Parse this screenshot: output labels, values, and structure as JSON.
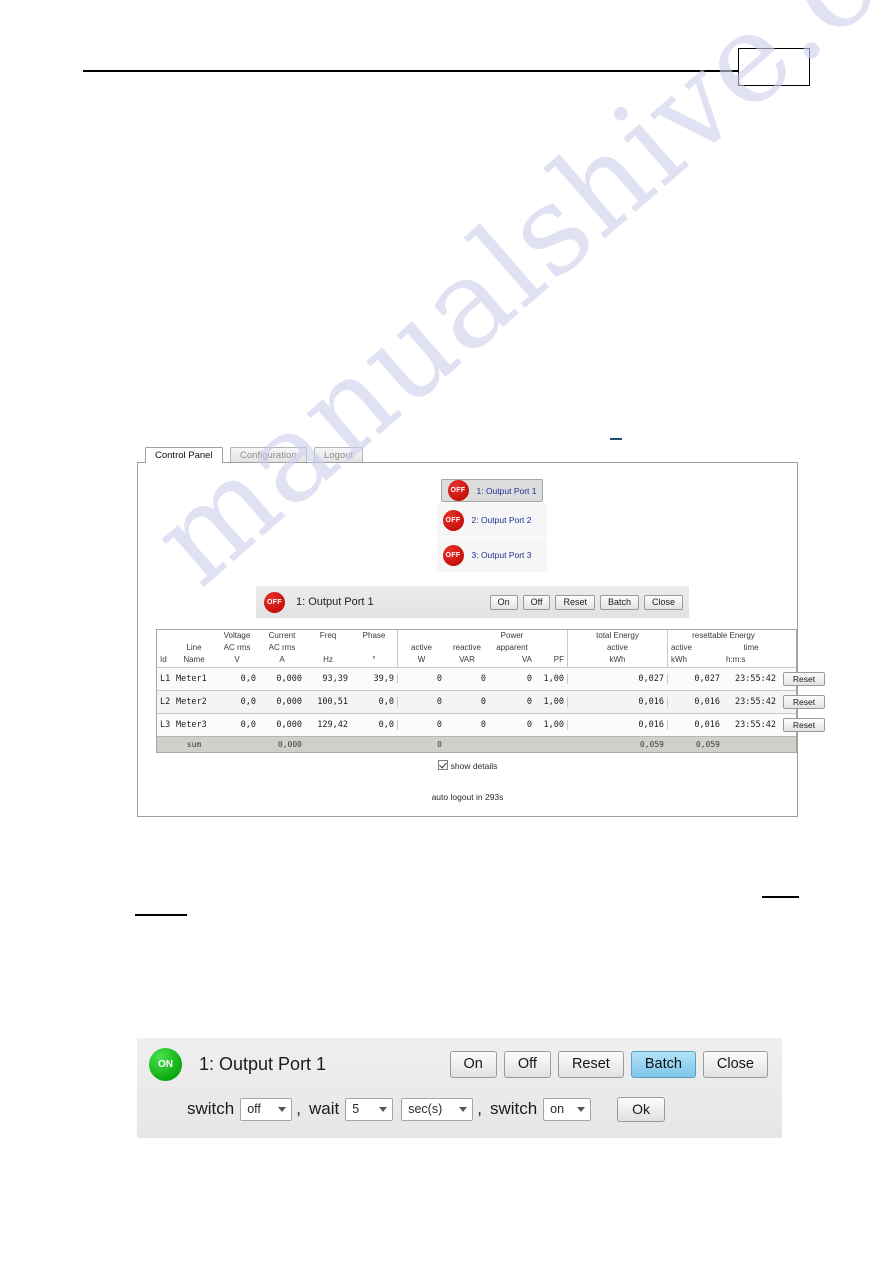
{
  "page": {
    "header_box_label": "",
    "redaction_marks": 3
  },
  "watermark": {
    "text": "manualshive.com"
  },
  "screenshot": {
    "tabs": [
      {
        "label": "Control Panel",
        "active": true
      },
      {
        "label": "Configuration",
        "active": false
      },
      {
        "label": "Logout",
        "active": false
      }
    ],
    "port_list": [
      {
        "state": "OFF",
        "label": "1: Output Port 1",
        "selected": true
      },
      {
        "state": "OFF",
        "label": "2: Output Port 2",
        "selected": false
      },
      {
        "state": "OFF",
        "label": "3: Output Port 3",
        "selected": false
      }
    ],
    "control_strip": {
      "state": "OFF",
      "title": "1: Output Port 1",
      "buttons": [
        "On",
        "Off",
        "Reset",
        "Batch",
        "Close"
      ]
    },
    "table": {
      "header": {
        "id": "Id",
        "line": "Line",
        "name": "Name",
        "voltage_title": "Voltage",
        "voltage_sub": "AC rms",
        "voltage_unit": "V",
        "current_title": "Current",
        "current_sub": "AC rms",
        "current_unit": "A",
        "freq_title": "Freq",
        "freq_unit": "Hz",
        "phase_title": "Phase",
        "phase_unit": "°",
        "power_group": "Power",
        "power_active": "active",
        "power_active_unit": "W",
        "power_reactive": "reactive",
        "power_reactive_unit": "VAR",
        "power_apparent": "apparent",
        "power_apparent_unit": "VA",
        "power_pf": "PF",
        "total_energy_group": "total Energy",
        "total_energy_active": "active",
        "total_energy_unit": "kWh",
        "resettable_group": "resettable Energy",
        "resettable_active": "active",
        "resettable_unit": "kWh",
        "resettable_time": "time",
        "resettable_time_unit": "h:m:s"
      },
      "rows": [
        {
          "id": "L1",
          "name": "Meter1",
          "voltage": "0,0",
          "current": "0,000",
          "freq": "93,39",
          "phase": "39,9",
          "p_active": "0",
          "p_reactive": "0",
          "p_apparent": "0",
          "pf": "1,00",
          "total_active": "0,027",
          "res_active": "0,027",
          "res_time": "23:55:42",
          "reset_label": "Reset"
        },
        {
          "id": "L2",
          "name": "Meter2",
          "voltage": "0,0",
          "current": "0,000",
          "freq": "100,51",
          "phase": "0,0",
          "p_active": "0",
          "p_reactive": "0",
          "p_apparent": "0",
          "pf": "1,00",
          "total_active": "0,016",
          "res_active": "0,016",
          "res_time": "23:55:42",
          "reset_label": "Reset"
        },
        {
          "id": "L3",
          "name": "Meter3",
          "voltage": "0,0",
          "current": "0,000",
          "freq": "129,42",
          "phase": "0,0",
          "p_active": "0",
          "p_reactive": "0",
          "p_apparent": "0",
          "pf": "1,00",
          "total_active": "0,016",
          "res_active": "0,016",
          "res_time": "23:55:42",
          "reset_label": "Reset"
        }
      ],
      "sum": {
        "label": "sum",
        "current": "0,000",
        "p_active": "0",
        "total_active": "0,059",
        "res_active": "0,059"
      }
    },
    "show_details_label": "show details",
    "show_details_checked": true,
    "auto_logout": "auto logout in 293s"
  },
  "zoom_panel": {
    "state": "ON",
    "title": "1: Output Port 1",
    "buttons": {
      "on": "On",
      "off": "Off",
      "reset": "Reset",
      "batch": "Batch",
      "close": "Close"
    },
    "batch_row": {
      "switch_label_1": "switch",
      "switch_value_1": "off",
      "comma_1": ",",
      "wait_label": "wait",
      "wait_value": "5",
      "unit_value": "sec(s)",
      "comma_2": ",",
      "switch_label_2": "switch",
      "switch_value_2": "on",
      "ok_label": "Ok"
    }
  },
  "colors": {
    "badge_off": "#c5120b",
    "badge_on": "#0ba80f",
    "primary_button": "#7cc6ec",
    "port_link": "#1f2f8f",
    "watermark": "#cfcfee"
  }
}
